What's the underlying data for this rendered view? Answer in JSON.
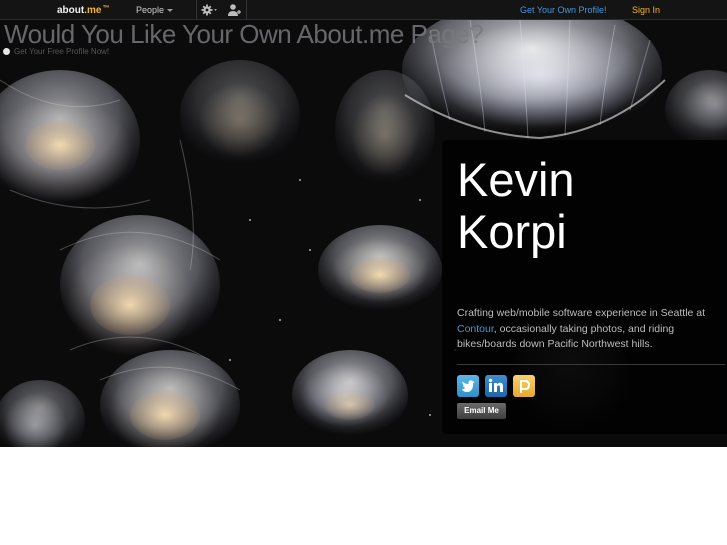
{
  "topbar": {
    "logo_text": "about",
    "logo_dot": ".me",
    "logo_tm": "™",
    "people_label": "People",
    "get_profile_label": "Get Your Own Profile!",
    "signin_label": "Sign In",
    "icons": [
      "gear-icon",
      "person-icon"
    ]
  },
  "banner": {
    "title": "Would You Like Your Own About.me Page?",
    "subtitle": "Get Your Free Profile Now!"
  },
  "profile": {
    "name_first": "Kevin",
    "name_last": "Korpi",
    "bio_before": "Crafting web/mobile software experience in Seattle at ",
    "bio_link": "Contour",
    "bio_after": ", occasionally taking photos, and riding bikes/boards down Pacific Northwest hills.",
    "social": [
      "twitter-icon",
      "linkedin-icon",
      "posterous-icon"
    ],
    "email_button": "Email Me"
  },
  "colors": {
    "accent": "#f2b632",
    "link": "#4a95d6",
    "topbar_bg": "#141414"
  }
}
